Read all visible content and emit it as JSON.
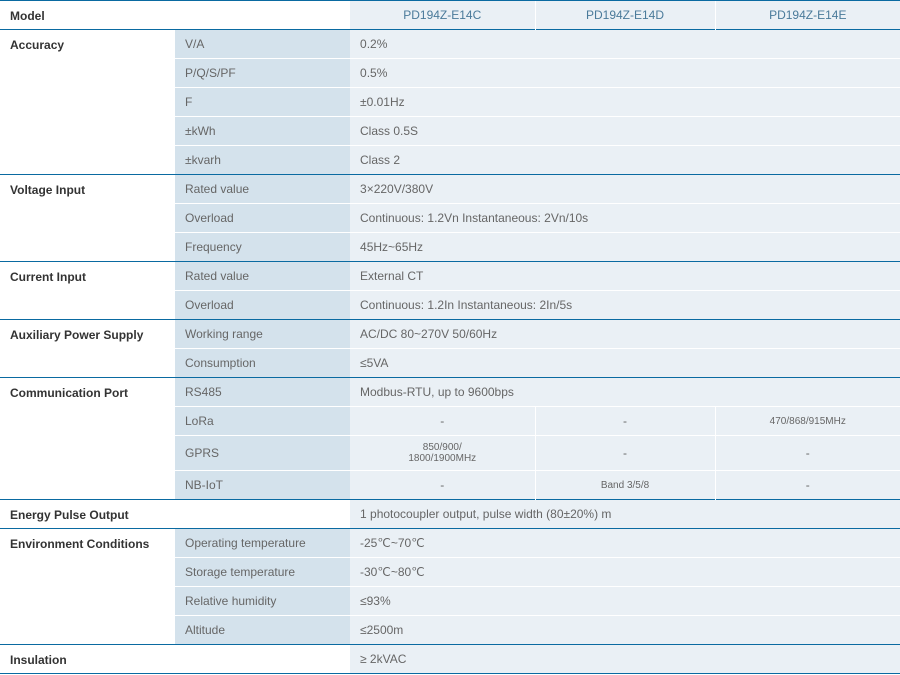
{
  "header": {
    "model_label": "Model",
    "m1": "PD194Z-E14C",
    "m2": "PD194Z-E14D",
    "m3": "PD194Z-E14E"
  },
  "accuracy": {
    "label": "Accuracy",
    "rows": {
      "va": {
        "param": "V/A",
        "val": "0.2%"
      },
      "pqspf": {
        "param": "P/Q/S/PF",
        "val": "0.5%"
      },
      "f": {
        "param": "F",
        "val": "±0.01Hz"
      },
      "kwh": {
        "param": "±kWh",
        "val": "Class 0.5S"
      },
      "kvarh": {
        "param": "±kvarh",
        "val": "Class 2"
      }
    }
  },
  "voltage": {
    "label": "Voltage Input",
    "rated": {
      "param": "Rated value",
      "val": "3×220V/380V"
    },
    "overload": {
      "param": "Overload",
      "val": "Continuous: 1.2Vn   Instantaneous: 2Vn/10s"
    },
    "freq": {
      "param": "Frequency",
      "val": "45Hz~65Hz"
    }
  },
  "current": {
    "label": "Current Input",
    "rated": {
      "param": "Rated value",
      "val": "External CT"
    },
    "overload": {
      "param": "Overload",
      "val": "Continuous: 1.2In   Instantaneous: 2In/5s"
    }
  },
  "aux": {
    "label": "Auxiliary Power Supply",
    "range": {
      "param": "Working range",
      "val": "AC/DC  80~270V 50/60Hz"
    },
    "cons": {
      "param": "Consumption",
      "val": "≤5VA"
    }
  },
  "comm": {
    "label": "Communication Port",
    "rs485": {
      "param": "RS485",
      "val": "Modbus-RTU, up to 9600bps"
    },
    "lora": {
      "param": "LoRa",
      "m1": "-",
      "m2": "-",
      "m3": "470/868/915MHz"
    },
    "gprs": {
      "param": "GPRS",
      "m1": "850/900/\n1800/1900MHz",
      "m2": "-",
      "m3": "-"
    },
    "nbiot": {
      "param": "NB-IoT",
      "m1": "-",
      "m2": "Band 3/5/8",
      "m3": "-"
    }
  },
  "epo": {
    "label": "Energy Pulse Output",
    "val": "1 photocoupler output, pulse width (80±20%) m"
  },
  "env": {
    "label": "Environment Conditions",
    "op": {
      "param": "Operating temperature",
      "val": "-25℃~70℃"
    },
    "stor": {
      "param": "Storage temperature",
      "val": "-30℃~80℃"
    },
    "rh": {
      "param": "Relative humidity",
      "val": "≤93%"
    },
    "alt": {
      "param": "Altitude",
      "val": "≤2500m"
    }
  },
  "insulation": {
    "label": "Insulation",
    "val": "≥ 2kVAC"
  }
}
